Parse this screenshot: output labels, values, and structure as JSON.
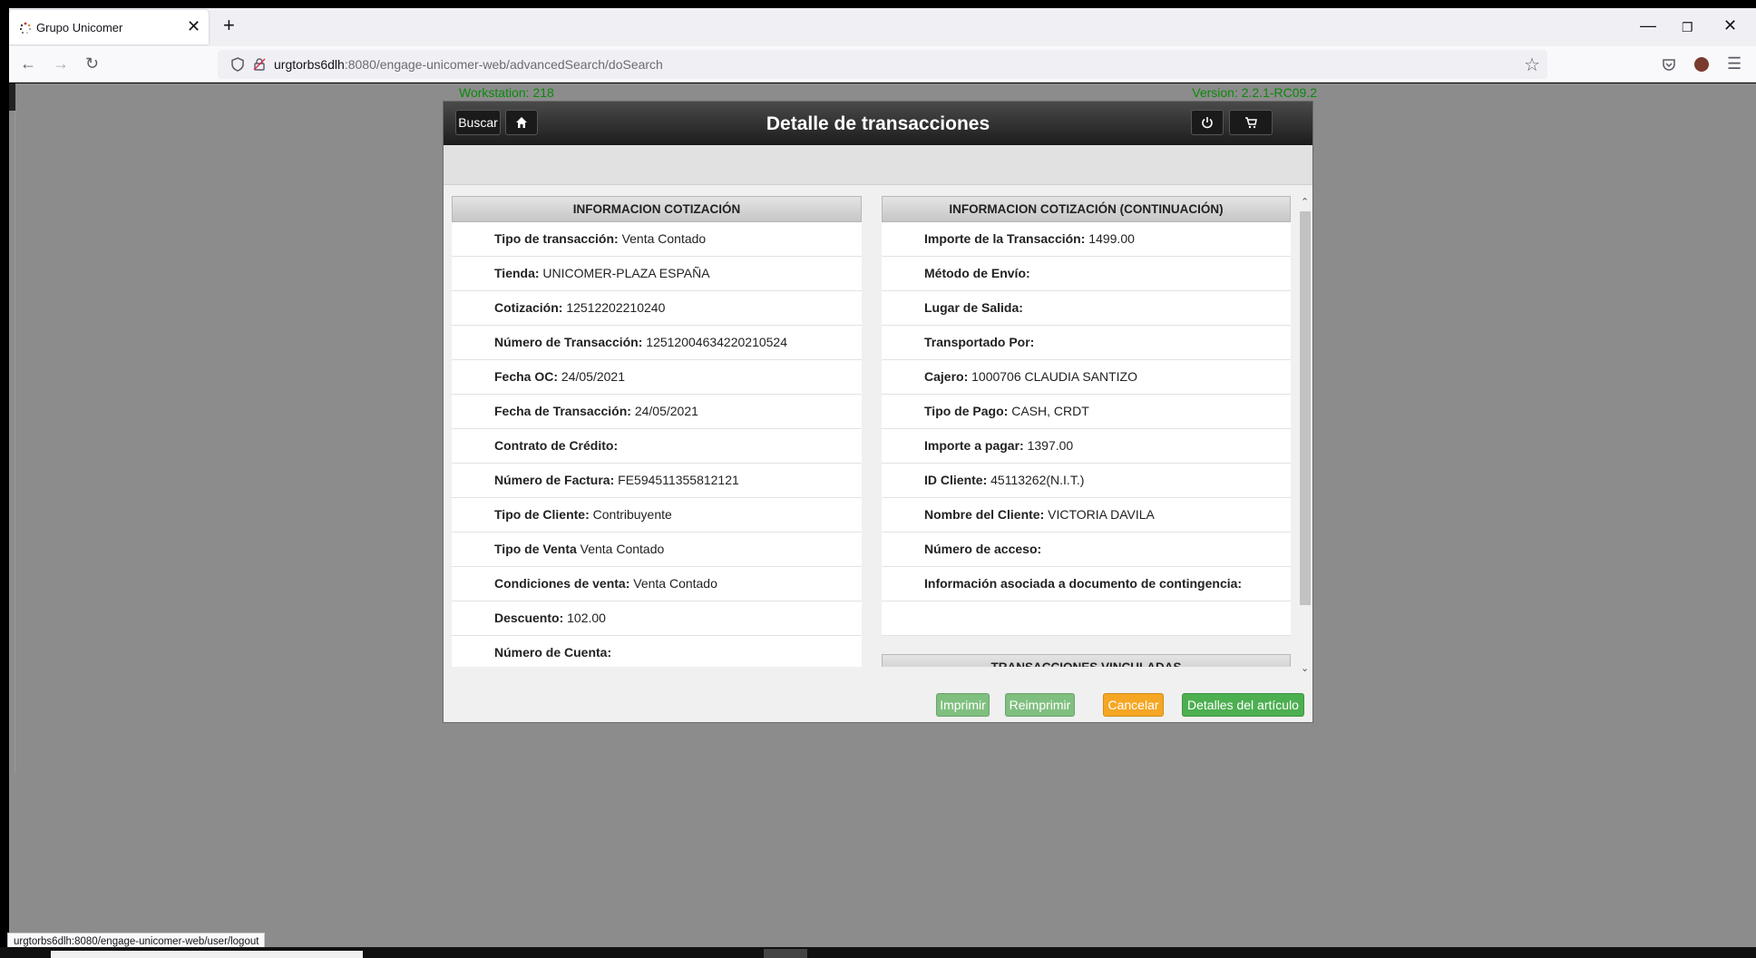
{
  "browser": {
    "tab_title": "Grupo Unicomer",
    "url_host": "urgtorbs6dlh",
    "url_path": ":8080/engage-unicomer-web/advancedSearch/doSearch",
    "status_url": "urgtorbs6dlh:8080/engage-unicomer-web/user/logout",
    "icons": [
      "back-arrow-icon",
      "forward-arrow-icon",
      "reload-icon",
      "shield-icon",
      "lock-icon",
      "star-icon",
      "pocket-icon",
      "account-icon",
      "menu-icon"
    ]
  },
  "page": {
    "workstation": "Workstation: 218",
    "version": "Version: 2.2.1-RC09.2"
  },
  "dialog": {
    "title": "Detalle de transacciones",
    "search_label": "Buscar",
    "left_header": "INFORMACION COTIZACIÓN",
    "right_header": "INFORMACION COTIZACIÓN (CONTINUACIÓN)",
    "linked_header": "TRANSACCIONES VINCULADAS",
    "left_rows": [
      {
        "label": "Tipo de transacción:",
        "value": "Venta Contado"
      },
      {
        "label": "Tienda:",
        "value": "UNICOMER-PLAZA ESPAÑA"
      },
      {
        "label": "Cotización:",
        "value": "12512202210240"
      },
      {
        "label": "Número de Transacción:",
        "value": "12512004634220210524"
      },
      {
        "label": "Fecha OC:",
        "value": "24/05/2021"
      },
      {
        "label": "Fecha de Transacción:",
        "value": "24/05/2021"
      },
      {
        "label": "Contrato de Crédito:",
        "value": ""
      },
      {
        "label": "Número de Factura:",
        "value": "FE594511355812121"
      },
      {
        "label": "Tipo de Cliente:",
        "value": "Contribuyente"
      },
      {
        "label": "Tipo de Venta",
        "value": "Venta Contado"
      },
      {
        "label": "Condiciones de venta:",
        "value": "Venta Contado"
      },
      {
        "label": "Descuento:",
        "value": "102.00"
      },
      {
        "label": "Número de Cuenta:",
        "value": ""
      }
    ],
    "right_rows": [
      {
        "label": "Importe de la Transacción:",
        "value": "1499.00"
      },
      {
        "label": "Método de Envío:",
        "value": ""
      },
      {
        "label": "Lugar de Salida:",
        "value": ""
      },
      {
        "label": "Transportado Por:",
        "value": ""
      },
      {
        "label": "Cajero:",
        "value": "1000706 CLAUDIA SANTIZO"
      },
      {
        "label": "Tipo de Pago:",
        "value": "CASH, CRDT"
      },
      {
        "label": "Importe a pagar:",
        "value": "1397.00"
      },
      {
        "label": "ID Cliente:",
        "value": " 45113262(N.I.T.)"
      },
      {
        "label": "Nombre del Cliente:",
        "value": "VICTORIA DAVILA"
      },
      {
        "label": "Número de acceso:",
        "value": ""
      },
      {
        "label": "Información asociada a documento de contingencia:",
        "value": ""
      }
    ],
    "buttons": {
      "print": "Imprimir",
      "reprint": "Reimprimir",
      "cancel": "Cancelar",
      "item_details": "Detalles del artículo"
    },
    "colors": {
      "print": "#7fbf7f",
      "reprint": "#7fbf7f",
      "cancel": "#f5a623",
      "item_details": "#4caf50",
      "header_text_green": "#0a8a0a"
    }
  }
}
